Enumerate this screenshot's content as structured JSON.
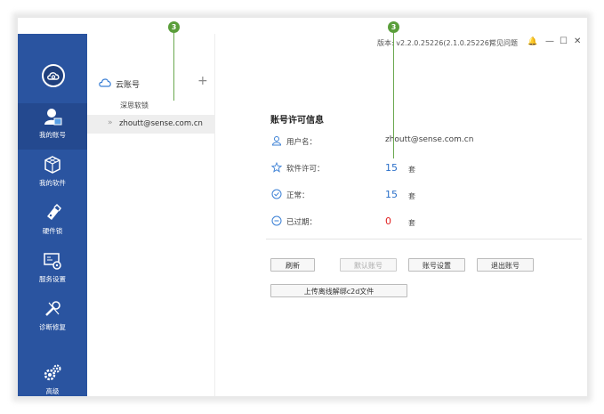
{
  "titlebar": {
    "version": "版本: v2.2.0.25226(2.1.0.25226)",
    "faq": "常见问题",
    "bell": "🔔",
    "minimize": "—",
    "maximize": "☐",
    "close": "✕"
  },
  "nav": {
    "items": [
      {
        "label": "我的账号"
      },
      {
        "label": "我的软件"
      },
      {
        "label": "硬件锁"
      },
      {
        "label": "服务设置"
      },
      {
        "label": "诊断修复"
      },
      {
        "label": "高级"
      }
    ]
  },
  "accounts": {
    "title": "云账号",
    "add": "+",
    "sub": "深思软锁",
    "chevron": "»",
    "email": "zhoutt@sense.com.cn"
  },
  "info": {
    "title": "账号许可信息",
    "rows": [
      {
        "label": "用户名：",
        "value": "zhoutt@sense.com.cn"
      },
      {
        "label": "软件许可：",
        "value": "15",
        "unit": "套"
      },
      {
        "label": "正常：",
        "value": "15",
        "unit": "套"
      },
      {
        "label": "已过期：",
        "value": "0",
        "unit": "套"
      }
    ],
    "colors": {
      "blue": "#2a6fc9",
      "red": "#e02020"
    }
  },
  "buttons": {
    "refresh": "刷新",
    "default_account": "默认账号",
    "account_settings": "账号设置",
    "logout": "退出账号",
    "upload": "上传离线解绑c2d文件"
  },
  "annotations": {
    "a": "3",
    "b": "3"
  }
}
